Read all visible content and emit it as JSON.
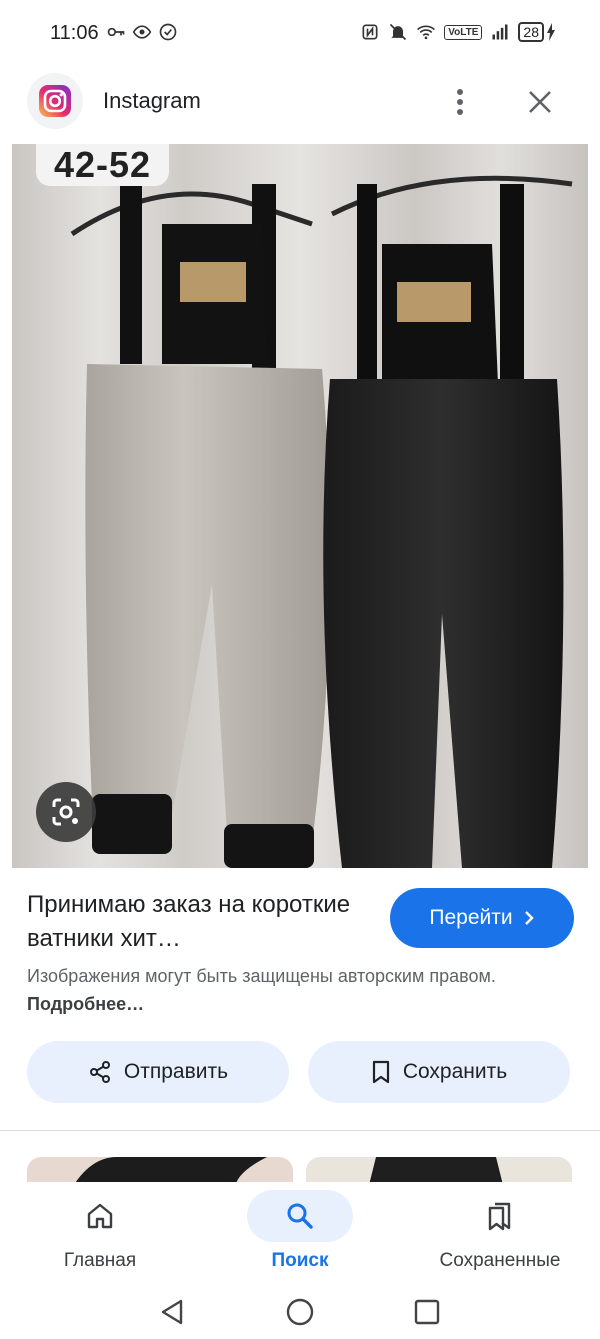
{
  "status_bar": {
    "time": "11:06",
    "left_icons": [
      "key-icon",
      "eye-icon",
      "check-circle-icon"
    ],
    "right_icons": [
      "nfc-icon",
      "mute-icon",
      "wifi-icon",
      "volte-icon",
      "signal-icon",
      "battery-icon"
    ],
    "volte": "VoLTE",
    "battery": "28"
  },
  "header": {
    "app_name": "Instagram",
    "app_icon": "instagram-icon",
    "more_icon": "more-vert-icon",
    "close_icon": "close-icon"
  },
  "image": {
    "overlay_text": "42-52",
    "lens_icon": "lens-icon"
  },
  "result": {
    "title": "Принимаю заказ на короткие ватники хит…",
    "visit_label": "Перейти",
    "copyright_text": "Изображения могут быть защищены авторским правом.",
    "more_link": "Подробнее…"
  },
  "actions": {
    "share_label": "Отправить",
    "save_label": "Сохранить"
  },
  "bottom_nav": {
    "items": [
      {
        "label": "Главная",
        "icon": "home-icon",
        "active": false
      },
      {
        "label": "Поиск",
        "icon": "search-icon",
        "active": true
      },
      {
        "label": "Сохраненные",
        "icon": "bookmarks-icon",
        "active": false
      }
    ]
  },
  "colors": {
    "accent": "#1a73e8",
    "pill_bg": "#e8f0fe",
    "text_primary": "#202124",
    "text_secondary": "#5f6368"
  }
}
